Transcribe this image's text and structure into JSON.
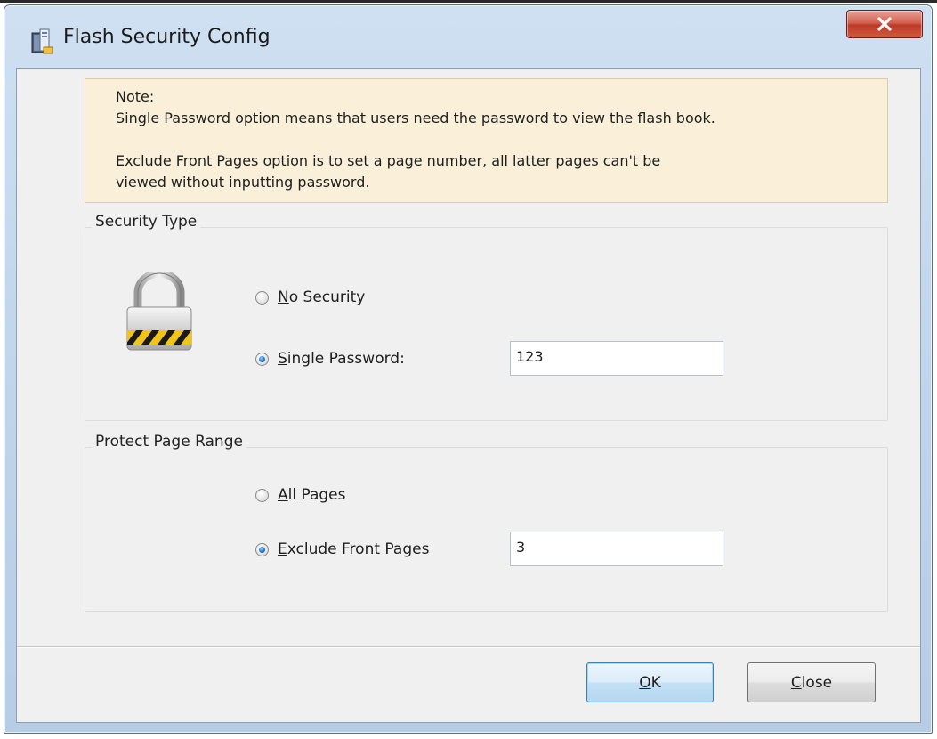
{
  "window": {
    "title": "Flash Security Config"
  },
  "note": {
    "lines": [
      "Note:",
      "Single Password option means that users need the password to view the flash book.",
      "",
      "Exclude Front Pages option is to set a page number, all latter pages can't be",
      "viewed without inputting password."
    ]
  },
  "security_type": {
    "legend": "Security Type",
    "no_security": {
      "label_first": "N",
      "label_rest": "o Security",
      "selected": false
    },
    "single_password": {
      "label_first": "S",
      "label_rest": "ingle Password:",
      "selected": true,
      "value": "123"
    }
  },
  "page_range": {
    "legend": "Protect Page Range",
    "all_pages": {
      "label_first": "A",
      "label_rest": "ll Pages",
      "selected": false
    },
    "exclude_front": {
      "label_first": "E",
      "label_rest": "xclude Front Pages",
      "selected": true,
      "value": "3"
    }
  },
  "buttons": {
    "ok": {
      "label_first": "O",
      "label_rest": "K"
    },
    "close": {
      "label_first": "C",
      "label_rest": "lose"
    }
  },
  "icons": {
    "app": "flash-book-icon",
    "lock": "padlock-icon",
    "close": "close-x-icon"
  },
  "colors": {
    "note_background": "#faefd9",
    "close_button": "#c8462f",
    "radio_selected": "#1f73c8"
  }
}
